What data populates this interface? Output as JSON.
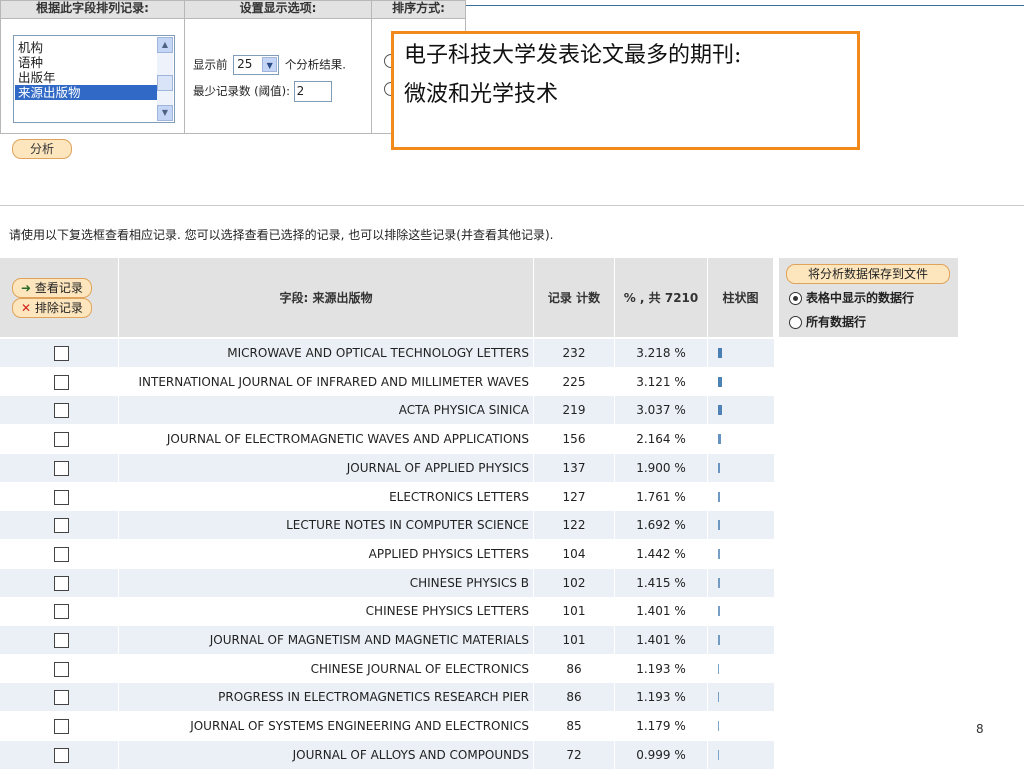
{
  "top_panels": {
    "sort_field": {
      "header": "根据此字段排列记录:",
      "options": [
        "机构",
        "语种",
        "出版年",
        "来源出版物"
      ],
      "selected": "来源出版物"
    },
    "display": {
      "header": "设置显示选项:",
      "show_prefix": "显示前",
      "show_count": "25",
      "show_suffix": "个分析结果.",
      "min_label": "最少记录数 (阈值):",
      "min_value": "2"
    },
    "sort_order": {
      "header": "排序方式:"
    }
  },
  "analyze_button": "分析",
  "callout": {
    "line1": "电子科技大学发表论文最多的期刊:",
    "line2": "微波和光学技术"
  },
  "instructions": "请使用以下复选框查看相应记录. 您可以选择查看已选择的记录, 也可以排除这些记录(并查看其他记录).",
  "table": {
    "view_records": "查看记录",
    "exclude_records": "排除记录",
    "col_field": "字段: 来源出版物",
    "col_count": "记录 计数",
    "col_percent": "% , 共 7210",
    "col_bar": "柱状图",
    "total": 7210,
    "rows": [
      {
        "name": "MICROWAVE AND OPTICAL TECHNOLOGY LETTERS",
        "count": "232",
        "pct": "3.218 %"
      },
      {
        "name": "INTERNATIONAL JOURNAL OF INFRARED AND MILLIMETER WAVES",
        "count": "225",
        "pct": "3.121 %"
      },
      {
        "name": "ACTA PHYSICA SINICA",
        "count": "219",
        "pct": "3.037 %"
      },
      {
        "name": "JOURNAL OF ELECTROMAGNETIC WAVES AND APPLICATIONS",
        "count": "156",
        "pct": "2.164 %"
      },
      {
        "name": "JOURNAL OF APPLIED PHYSICS",
        "count": "137",
        "pct": "1.900 %"
      },
      {
        "name": "ELECTRONICS LETTERS",
        "count": "127",
        "pct": "1.761 %"
      },
      {
        "name": "LECTURE NOTES IN COMPUTER SCIENCE",
        "count": "122",
        "pct": "1.692 %"
      },
      {
        "name": "APPLIED PHYSICS LETTERS",
        "count": "104",
        "pct": "1.442 %"
      },
      {
        "name": "CHINESE PHYSICS B",
        "count": "102",
        "pct": "1.415 %"
      },
      {
        "name": "CHINESE PHYSICS LETTERS",
        "count": "101",
        "pct": "1.401 %"
      },
      {
        "name": "JOURNAL OF MAGNETISM AND MAGNETIC MATERIALS",
        "count": "101",
        "pct": "1.401 %"
      },
      {
        "name": "CHINESE JOURNAL OF ELECTRONICS",
        "count": "86",
        "pct": "1.193 %"
      },
      {
        "name": "PROGRESS IN ELECTROMAGNETICS RESEARCH PIER",
        "count": "86",
        "pct": "1.193 %"
      },
      {
        "name": "JOURNAL OF SYSTEMS ENGINEERING AND ELECTRONICS",
        "count": "85",
        "pct": "1.179 %"
      },
      {
        "name": "JOURNAL OF ALLOYS AND COMPOUNDS",
        "count": "72",
        "pct": "0.999 %"
      }
    ]
  },
  "save_panel": {
    "button": "将分析数据保存到文件",
    "option_visible": "表格中显示的数据行",
    "option_all": "所有数据行",
    "selected": "option_visible"
  },
  "page_number": "8",
  "colors": {
    "callout_border": "#f28a1b",
    "header_bg": "#e2e2e2",
    "alt_row_bg": "#eaf0f6",
    "listbox_selected": "#3169c6",
    "bar": "#4a7fb3",
    "pill_bg": "#fde6bd"
  }
}
